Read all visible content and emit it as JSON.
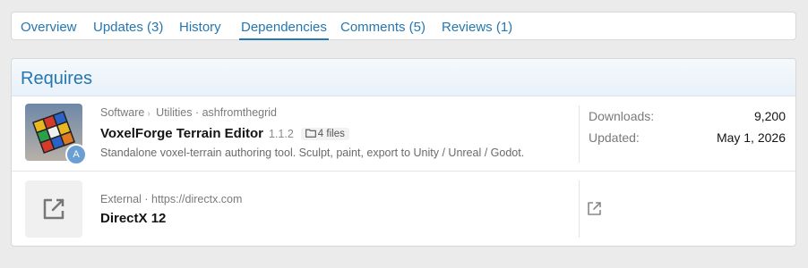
{
  "tabs": [
    {
      "label": "Overview"
    },
    {
      "label": "Updates (3)"
    },
    {
      "label": "History"
    },
    {
      "label": "Dependencies"
    },
    {
      "label": "Comments (5)"
    },
    {
      "label": "Reviews (1)"
    }
  ],
  "active_tab": "Dependencies",
  "section": {
    "title": "Requires"
  },
  "items": [
    {
      "category": "Software",
      "subcategory": "Utilities",
      "author": "ashfromthegrid",
      "title": "VoxelForge Terrain Editor",
      "version": "1.1.2",
      "files": "4 files",
      "description": "Standalone voxel-terrain authoring tool. Sculpt, paint, export to Unity / Unreal / Godot.",
      "avatar_letter": "A",
      "downloads_label": "Downloads:",
      "downloads_value": "9,200",
      "updated_label": "Updated:",
      "updated_value": "May 1, 2026"
    },
    {
      "source": "External",
      "url": "https://directx.com",
      "title": "DirectX 12"
    }
  ],
  "colors": {
    "link": "#2577b1",
    "background": "#ebebeb"
  },
  "icons": {
    "folder": "folder-icon",
    "external": "external-link-icon"
  }
}
